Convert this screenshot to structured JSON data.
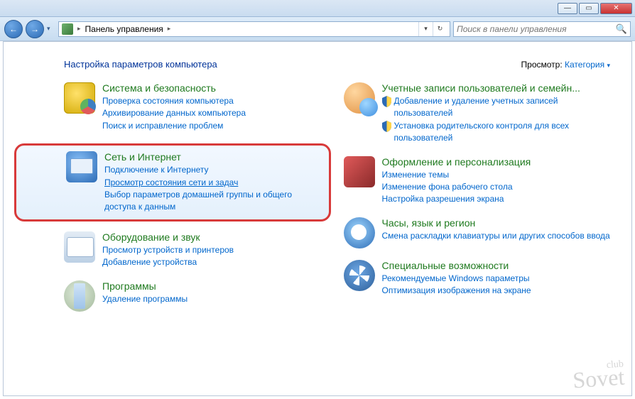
{
  "titlebar": {
    "min": "—",
    "max": "▭",
    "close": "✕"
  },
  "nav": {
    "back": "←",
    "fwd": "→",
    "drop": "▾",
    "crumb_root": "Панель управления",
    "crumb_arrow": "▸",
    "refresh": "↻",
    "addr_drop": "▾"
  },
  "search": {
    "placeholder": "Поиск в панели управления",
    "icon": "🔍"
  },
  "header": {
    "title": "Настройка параметров компьютера",
    "view_prefix": "Просмотр:",
    "view_value": "Категория",
    "drop": "▾"
  },
  "left": {
    "security": {
      "title": "Система и безопасность",
      "links": [
        "Проверка состояния компьютера",
        "Архивирование данных компьютера",
        "Поиск и исправление проблем"
      ]
    },
    "network": {
      "title": "Сеть и Интернет",
      "links": [
        "Подключение к Интернету",
        "Просмотр состояния сети и задач",
        "Выбор параметров домашней группы и общего доступа к данным"
      ]
    },
    "hardware": {
      "title": "Оборудование и звук",
      "links": [
        "Просмотр устройств и принтеров",
        "Добавление устройства"
      ]
    },
    "programs": {
      "title": "Программы",
      "links": [
        "Удаление программы"
      ]
    }
  },
  "right": {
    "users": {
      "title": "Учетные записи пользователей и семейн...",
      "shield_links": [
        "Добавление и удаление учетных записей пользователей",
        "Установка родительского контроля для всех пользователей"
      ]
    },
    "appearance": {
      "title": "Оформление и персонализация",
      "links": [
        "Изменение темы",
        "Изменение фона рабочего стола",
        "Настройка разрешения экрана"
      ]
    },
    "clock": {
      "title": "Часы, язык и регион",
      "links": [
        "Смена раскладки клавиатуры или других способов ввода"
      ]
    },
    "access": {
      "title": "Специальные возможности",
      "links": [
        "Рекомендуемые Windows параметры",
        "Оптимизация изображения на экране"
      ]
    }
  },
  "watermark": {
    "top": "club",
    "main": "Sovet"
  }
}
